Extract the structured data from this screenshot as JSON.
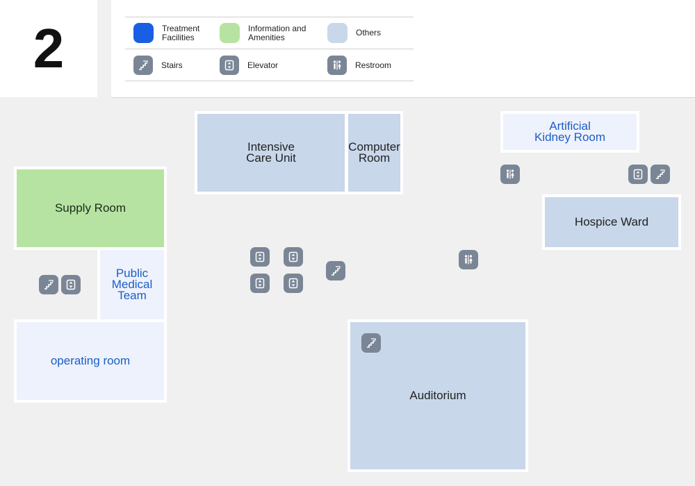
{
  "floor": {
    "number": "2"
  },
  "legend": {
    "categories": [
      {
        "label": "Treatment Facilities",
        "color": "#1a5fe3"
      },
      {
        "label": "Information and Amenities",
        "color": "#b6e3a1"
      },
      {
        "label": "Others",
        "color": "#c8d7ea"
      }
    ],
    "facilities": [
      {
        "label": "Stairs",
        "icon": "stairs-icon"
      },
      {
        "label": "Elevator",
        "icon": "elevator-icon"
      },
      {
        "label": "Restroom",
        "icon": "restroom-icon"
      }
    ]
  },
  "rooms": {
    "intensive_care_unit": "Intensive Care Unit",
    "computer_room": "Computer Room",
    "artificial_kidney_room": "Artificial Kidney Room",
    "supply_room": "Supply Room",
    "public_medical_team": "Public Medical Team",
    "operating_room": "operating room",
    "hospice_ward": "Hospice Ward",
    "auditorium": "Auditorium"
  },
  "colors": {
    "treatment": "#1a5fe3",
    "information": "#b6e3a1",
    "others": "#c8d7ea",
    "icon_bg": "#7a8696"
  }
}
